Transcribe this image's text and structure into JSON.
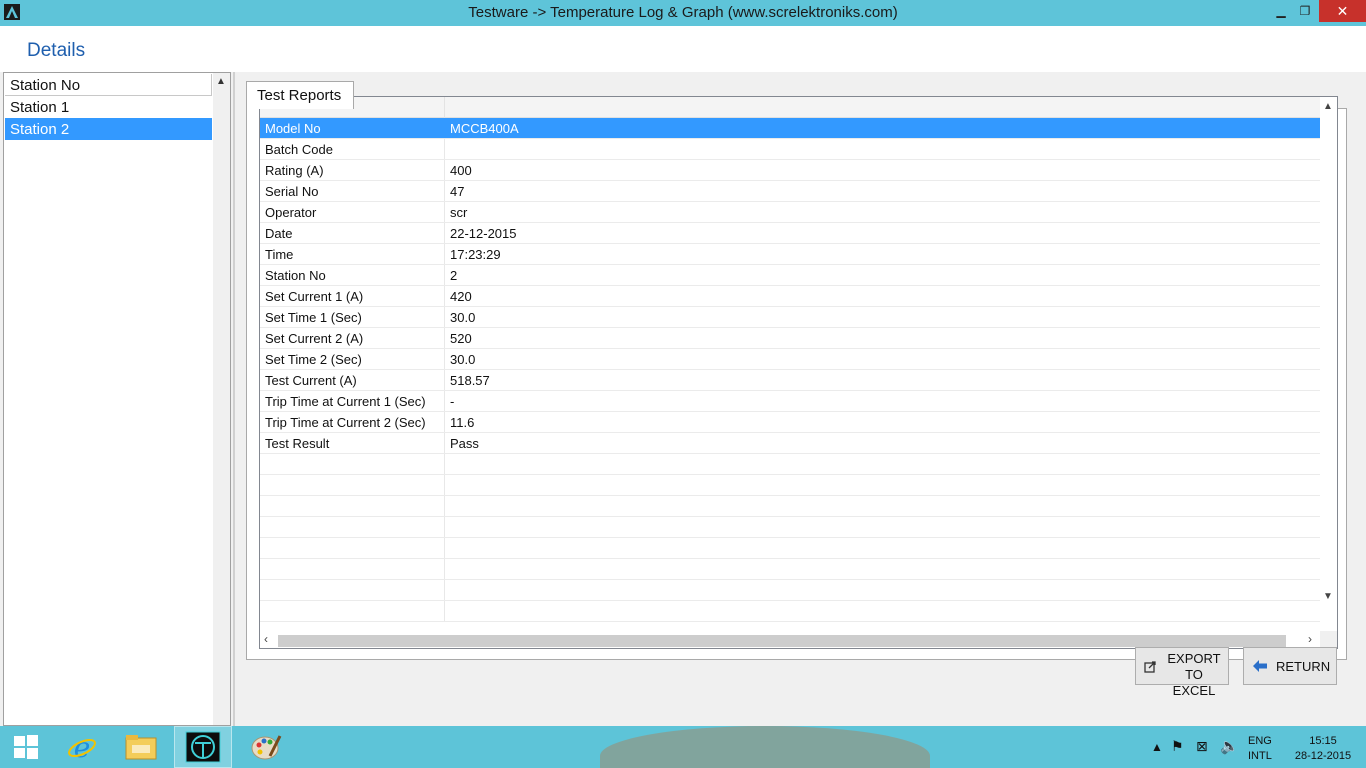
{
  "window": {
    "title": "Testware -> Temperature Log & Graph (www.screlektroniks.com)",
    "min_glyph": "▁",
    "max_glyph": "❐",
    "close_glyph": "✕"
  },
  "details_title": "Details",
  "stations": {
    "header": "Station No",
    "items": [
      "Station 1",
      "Station 2"
    ],
    "selected_index": 1
  },
  "tab": {
    "label": "Test Reports"
  },
  "report": {
    "rows": [
      {
        "label": "Model No",
        "value": "MCCB400A"
      },
      {
        "label": "Batch Code",
        "value": ""
      },
      {
        "label": "Rating (A)",
        "value": "400"
      },
      {
        "label": "Serial No",
        "value": "47"
      },
      {
        "label": "Operator",
        "value": "scr"
      },
      {
        "label": "Date",
        "value": "22-12-2015"
      },
      {
        "label": "Time",
        "value": "17:23:29"
      },
      {
        "label": "Station No",
        "value": "2"
      },
      {
        "label": "Set Current 1 (A)",
        "value": "420"
      },
      {
        "label": "Set Time 1 (Sec)",
        "value": "30.0"
      },
      {
        "label": "Set Current 2 (A)",
        "value": "520"
      },
      {
        "label": "Set Time 2 (Sec)",
        "value": "30.0"
      },
      {
        "label": "Test Current (A)",
        "value": "518.57"
      },
      {
        "label": "Trip Time at Current 1 (Sec)",
        "value": "-"
      },
      {
        "label": "Trip Time at Current 2 (Sec)",
        "value": "11.6"
      },
      {
        "label": "Test Result",
        "value": "Pass"
      }
    ],
    "selected_index": 0
  },
  "buttons": {
    "export_line1": "EXPORT",
    "export_line2": "TO EXCEL",
    "return": "RETURN"
  },
  "taskbar": {
    "lang_line1": "ENG",
    "lang_line2": "INTL",
    "time": "15:15",
    "date": "28-12-2015"
  },
  "colors": {
    "accent": "#3399ff",
    "titlebar": "#5ec4d9",
    "close": "#c7312b",
    "details_title": "#1f5fae"
  }
}
